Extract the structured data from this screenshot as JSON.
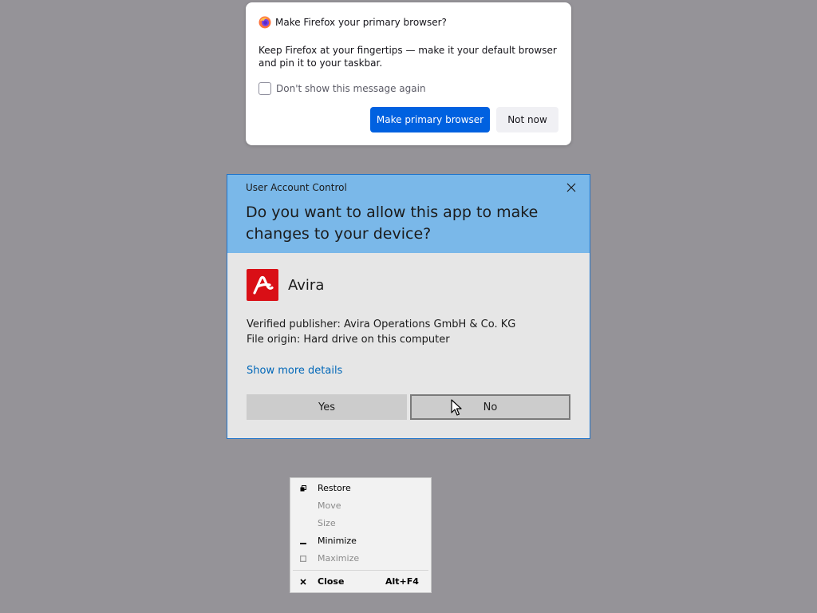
{
  "firefox_prompt": {
    "title": "Make Firefox your primary browser?",
    "message": "Keep Firefox at your fingertips — make it your default browser and pin it to your taskbar.",
    "checkbox_label": "Don't show this message again",
    "checkbox_checked": false,
    "primary_button": "Make primary browser",
    "secondary_button": "Not now",
    "logo_icon": "firefox-logo",
    "colors": {
      "primary": "#0061e0"
    }
  },
  "uac": {
    "caption": "User Account Control",
    "question": "Do you want to allow this app to make changes to your device?",
    "app_name": "Avira",
    "app_icon": "avira-logo",
    "publisher": "Verified publisher: Avira Operations GmbH & Co. KG",
    "origin": "File origin: Hard drive on this computer",
    "details_link": "Show more details",
    "yes_button": "Yes",
    "no_button": "No",
    "colors": {
      "header": "#7ab8e9",
      "app_icon_bg": "#d90f16",
      "link": "#0067b8"
    }
  },
  "system_menu": {
    "items": [
      {
        "label": "Restore",
        "icon": "restore-icon",
        "enabled": true
      },
      {
        "label": "Move",
        "icon": "",
        "enabled": false
      },
      {
        "label": "Size",
        "icon": "",
        "enabled": false
      },
      {
        "label": "Minimize",
        "icon": "minimize-icon",
        "enabled": true
      },
      {
        "label": "Maximize",
        "icon": "maximize-icon",
        "enabled": false
      },
      {
        "label": "Close",
        "icon": "close-icon",
        "enabled": true,
        "shortcut": "Alt+F4"
      }
    ]
  }
}
